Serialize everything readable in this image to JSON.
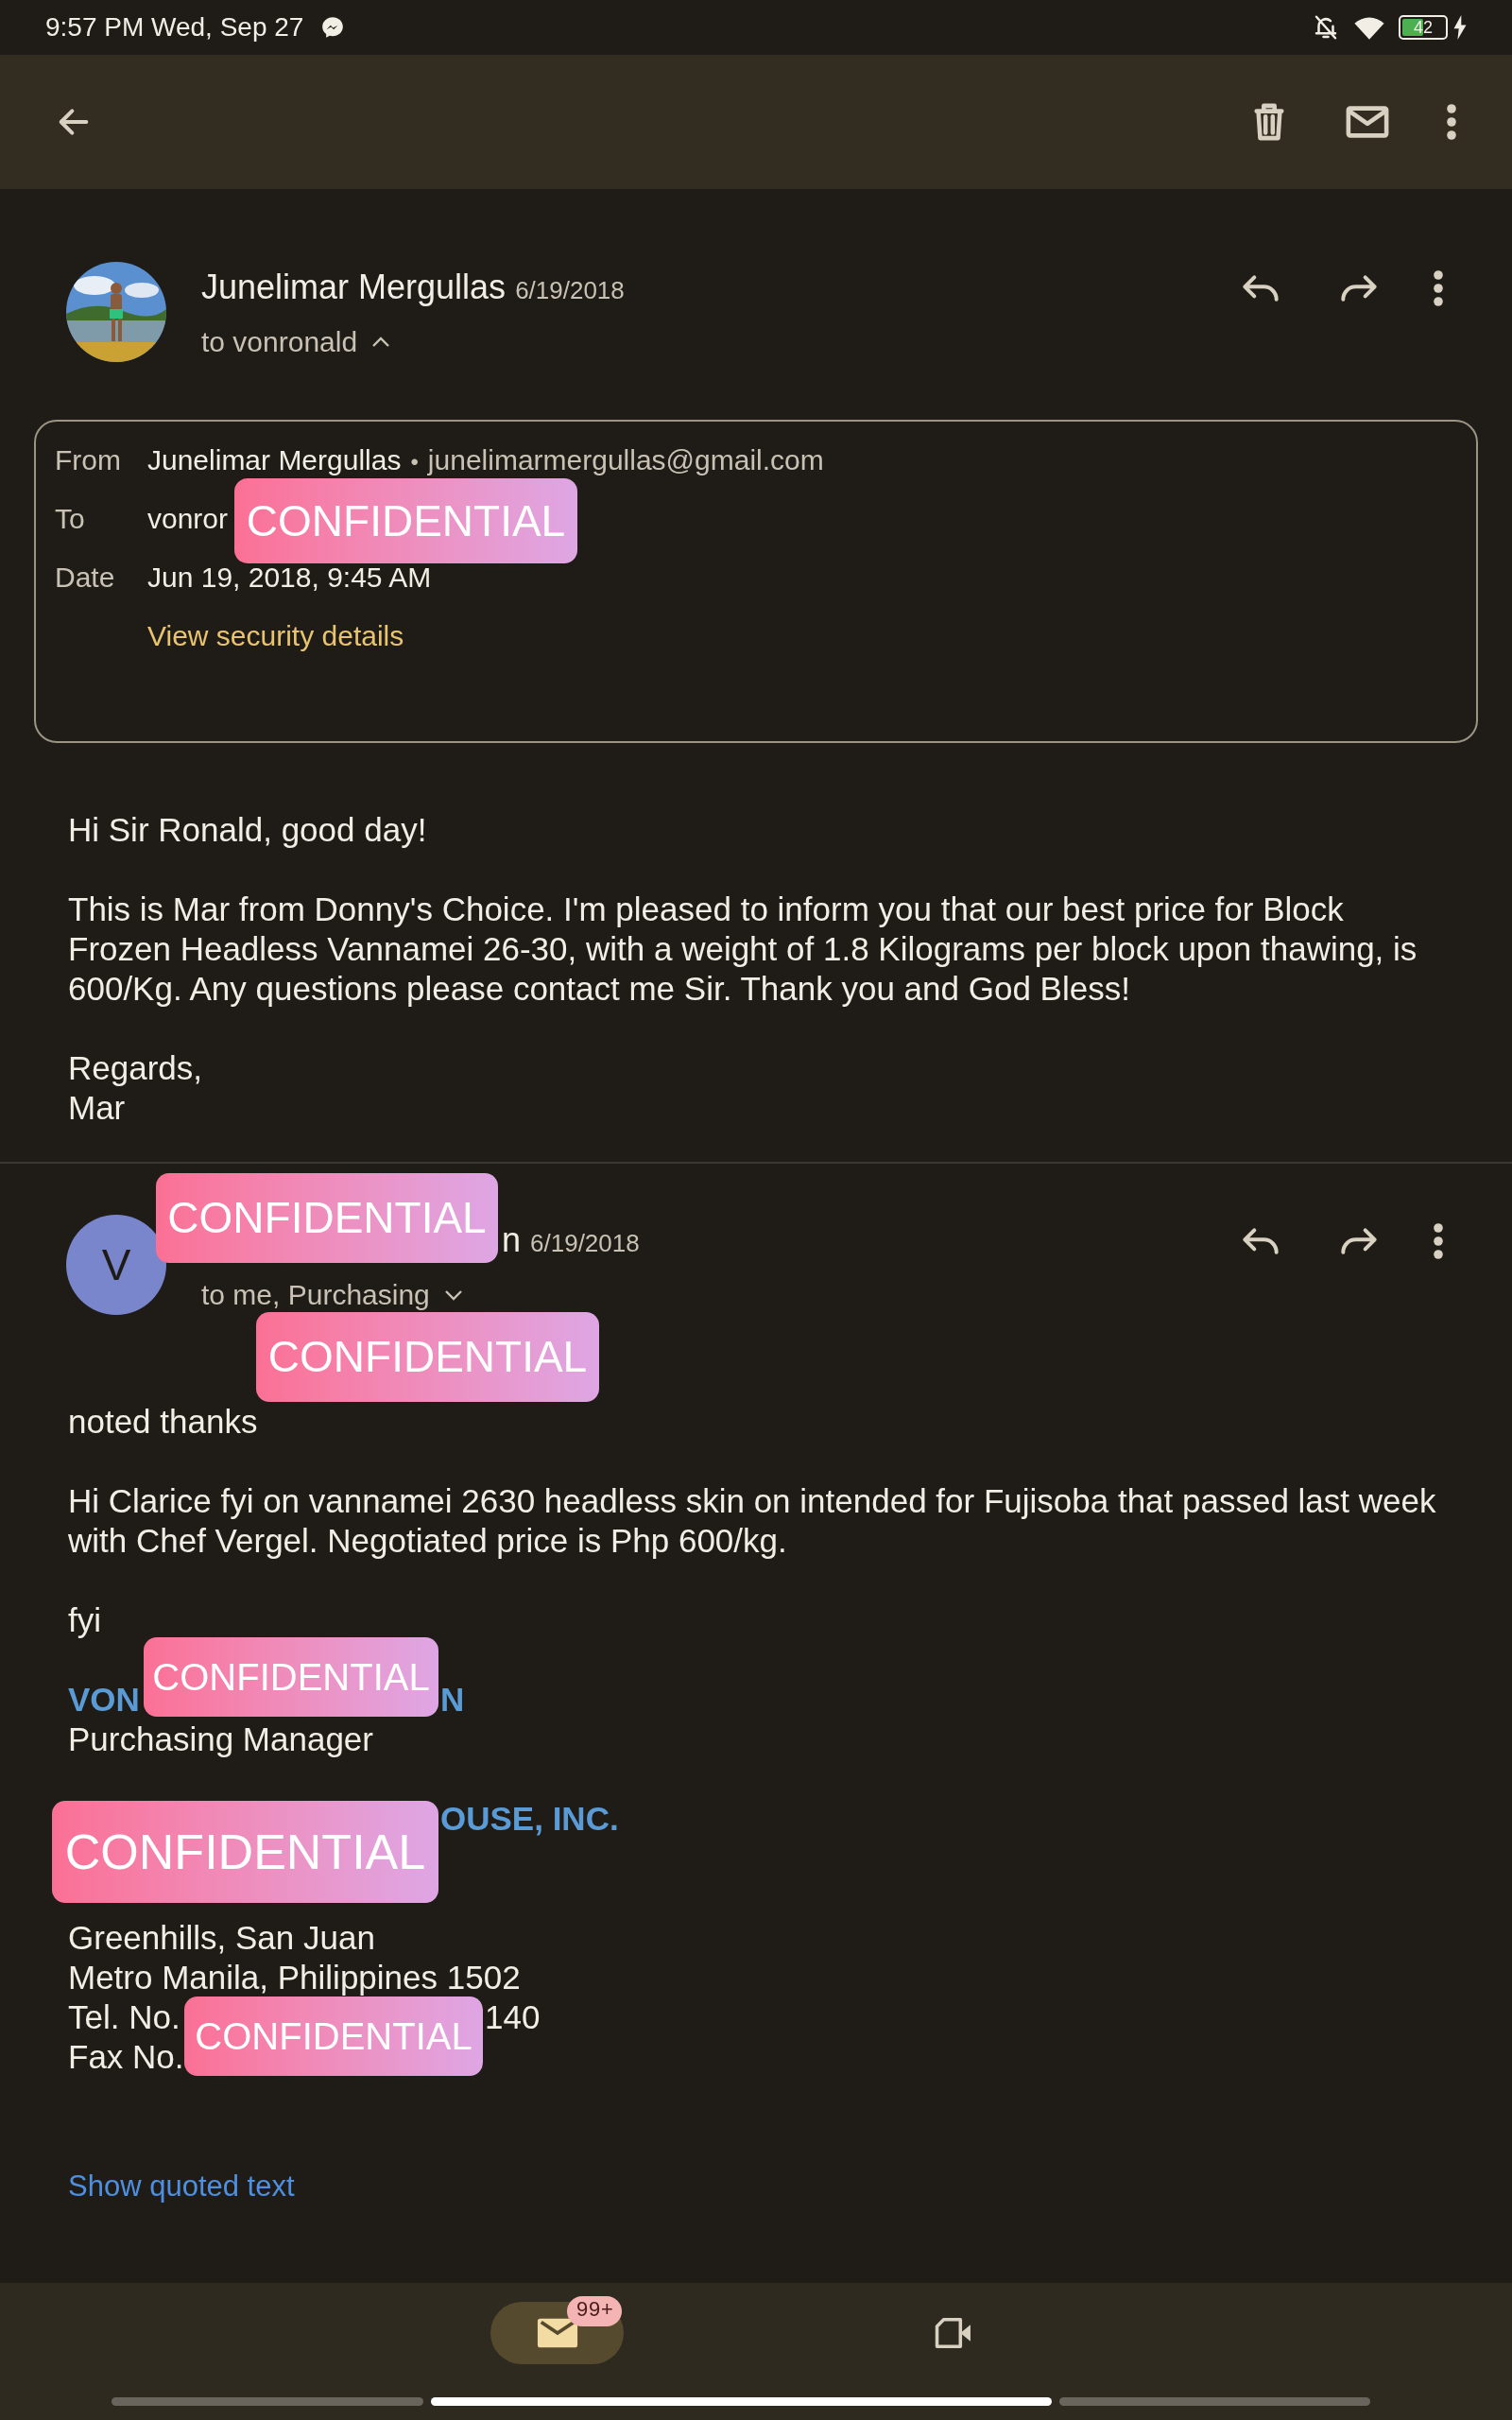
{
  "status_bar": {
    "time": "9:57 PM Wed, Sep 27",
    "battery": "42"
  },
  "messages": [
    {
      "sender": "Junelimar Mergullas",
      "date": "6/19/2018",
      "recipients": "to vonronald",
      "expanded": true,
      "details": {
        "rows": [
          {
            "label": "From",
            "value": "Junelimar Mergullas",
            "separator": "•",
            "email": "junelimarmergullas@gmail.com"
          },
          {
            "label": "To",
            "value": "vonror"
          },
          {
            "label": "Date",
            "value": "Jun 19, 2018, 9:45 AM"
          }
        ],
        "link": "View security details"
      },
      "body": [
        "Hi Sir Ronald, good day!",
        "This is Mar from Donny's Choice. I'm pleased to inform you that our best price for Block Frozen Headless Vannamei 26-30, with a weight of 1.8 Kilograms per block upon thawing, is 600/Kg. Any questions please contact me Sir. Thank you and God Bless!",
        "Regards,\nMar"
      ]
    },
    {
      "sender": "n",
      "date": "6/19/2018",
      "recipients": "to me, Purchasing",
      "expanded": false,
      "avatar": {
        "kind": "letter",
        "letter": "V"
      },
      "body": [
        "noted thanks",
        "Hi Clarice fyi on vannamei 2630 headless skin on intended for Fujisoba that passed last week with Chef Vergel. Negotiated price is Php 600/kg.",
        "fyi"
      ],
      "signature": [
        [
          {
            "kind": "heading-split",
            "parts": [
              "VON",
              "N"
            ]
          },
          {
            "kind": "plain",
            "parts": [
              "Purchasing Manager"
            ]
          }
        ],
        [
          {
            "kind": "heading-tail",
            "parts": [
              "OUSE, INC."
            ]
          },
          {
            "kind": "covered"
          },
          {
            "kind": "covered"
          },
          {
            "kind": "plain",
            "parts": [
              "Greenhills, San Juan"
            ]
          },
          {
            "kind": "plain",
            "parts": [
              "Metro Manila, Philippines 1502"
            ]
          },
          {
            "kind": "split",
            "parts": [
              "Tel. No.",
              "140"
            ]
          },
          {
            "kind": "plain",
            "parts": [
              "Fax No."
            ]
          }
        ]
      ],
      "link": "Show quoted text"
    }
  ],
  "redactions": [
    {
      "text": "CONFIDENTIAL"
    },
    {
      "text": "CONFIDENTIAL"
    },
    {
      "text": "CONFIDENTIAL"
    },
    {
      "text": "CONFIDENTIAL"
    },
    {
      "text": "CONFIDENTIAL"
    },
    {
      "text": "CONFIDENTIAL"
    }
  ],
  "bottom_nav": [
    {
      "kind": "mail",
      "badge": "99+",
      "selected": true
    },
    {
      "kind": "video",
      "selected": false
    }
  ]
}
